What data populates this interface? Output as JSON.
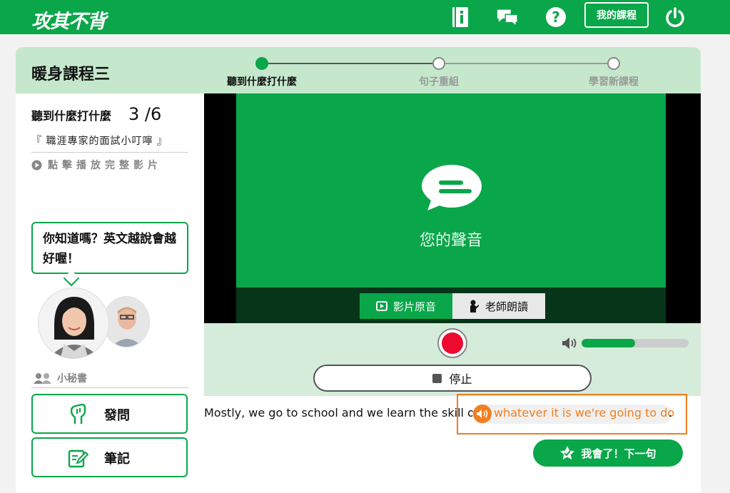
{
  "brand": {
    "logo_text": "攻其不背",
    "accent": "#0aa64a",
    "highlight": "#f07f20",
    "record": "#ee0a2e"
  },
  "topbar": {
    "icons": [
      "info-book-icon",
      "chat-icon",
      "help-icon",
      "power-icon"
    ],
    "my_course_label": "我的課程"
  },
  "course": {
    "title": "暖身課程三",
    "steps": [
      {
        "label": "聽到什麼打什麼",
        "active": true
      },
      {
        "label": "句子重組",
        "active": false
      },
      {
        "label": "學習新課程",
        "active": false
      }
    ]
  },
  "lesson": {
    "name": "聽到什麼打什麼",
    "count": "3 /6",
    "subtitle": "『 職涯專家的面試小叮嚀 』",
    "play_full": "點擊播放完整影片"
  },
  "assistant": {
    "bubble": "你知道嗎？英文越說會越好喔！",
    "label": "小秘書"
  },
  "side_buttons": {
    "ask": "發問",
    "notes": "筆記"
  },
  "video": {
    "voice_label": "您的聲音",
    "tabs": [
      "影片原音",
      "老師朗讀"
    ],
    "selected_tab": "影片原音"
  },
  "controls": {
    "volume_level": 0.5,
    "stop_label": "停止"
  },
  "sentence": {
    "prefix": "Mostly, we go to school and we learn the skill of",
    "highlight": "whatever it is we're going to do",
    "suffix": "."
  },
  "next_button": "我會了！下一句"
}
